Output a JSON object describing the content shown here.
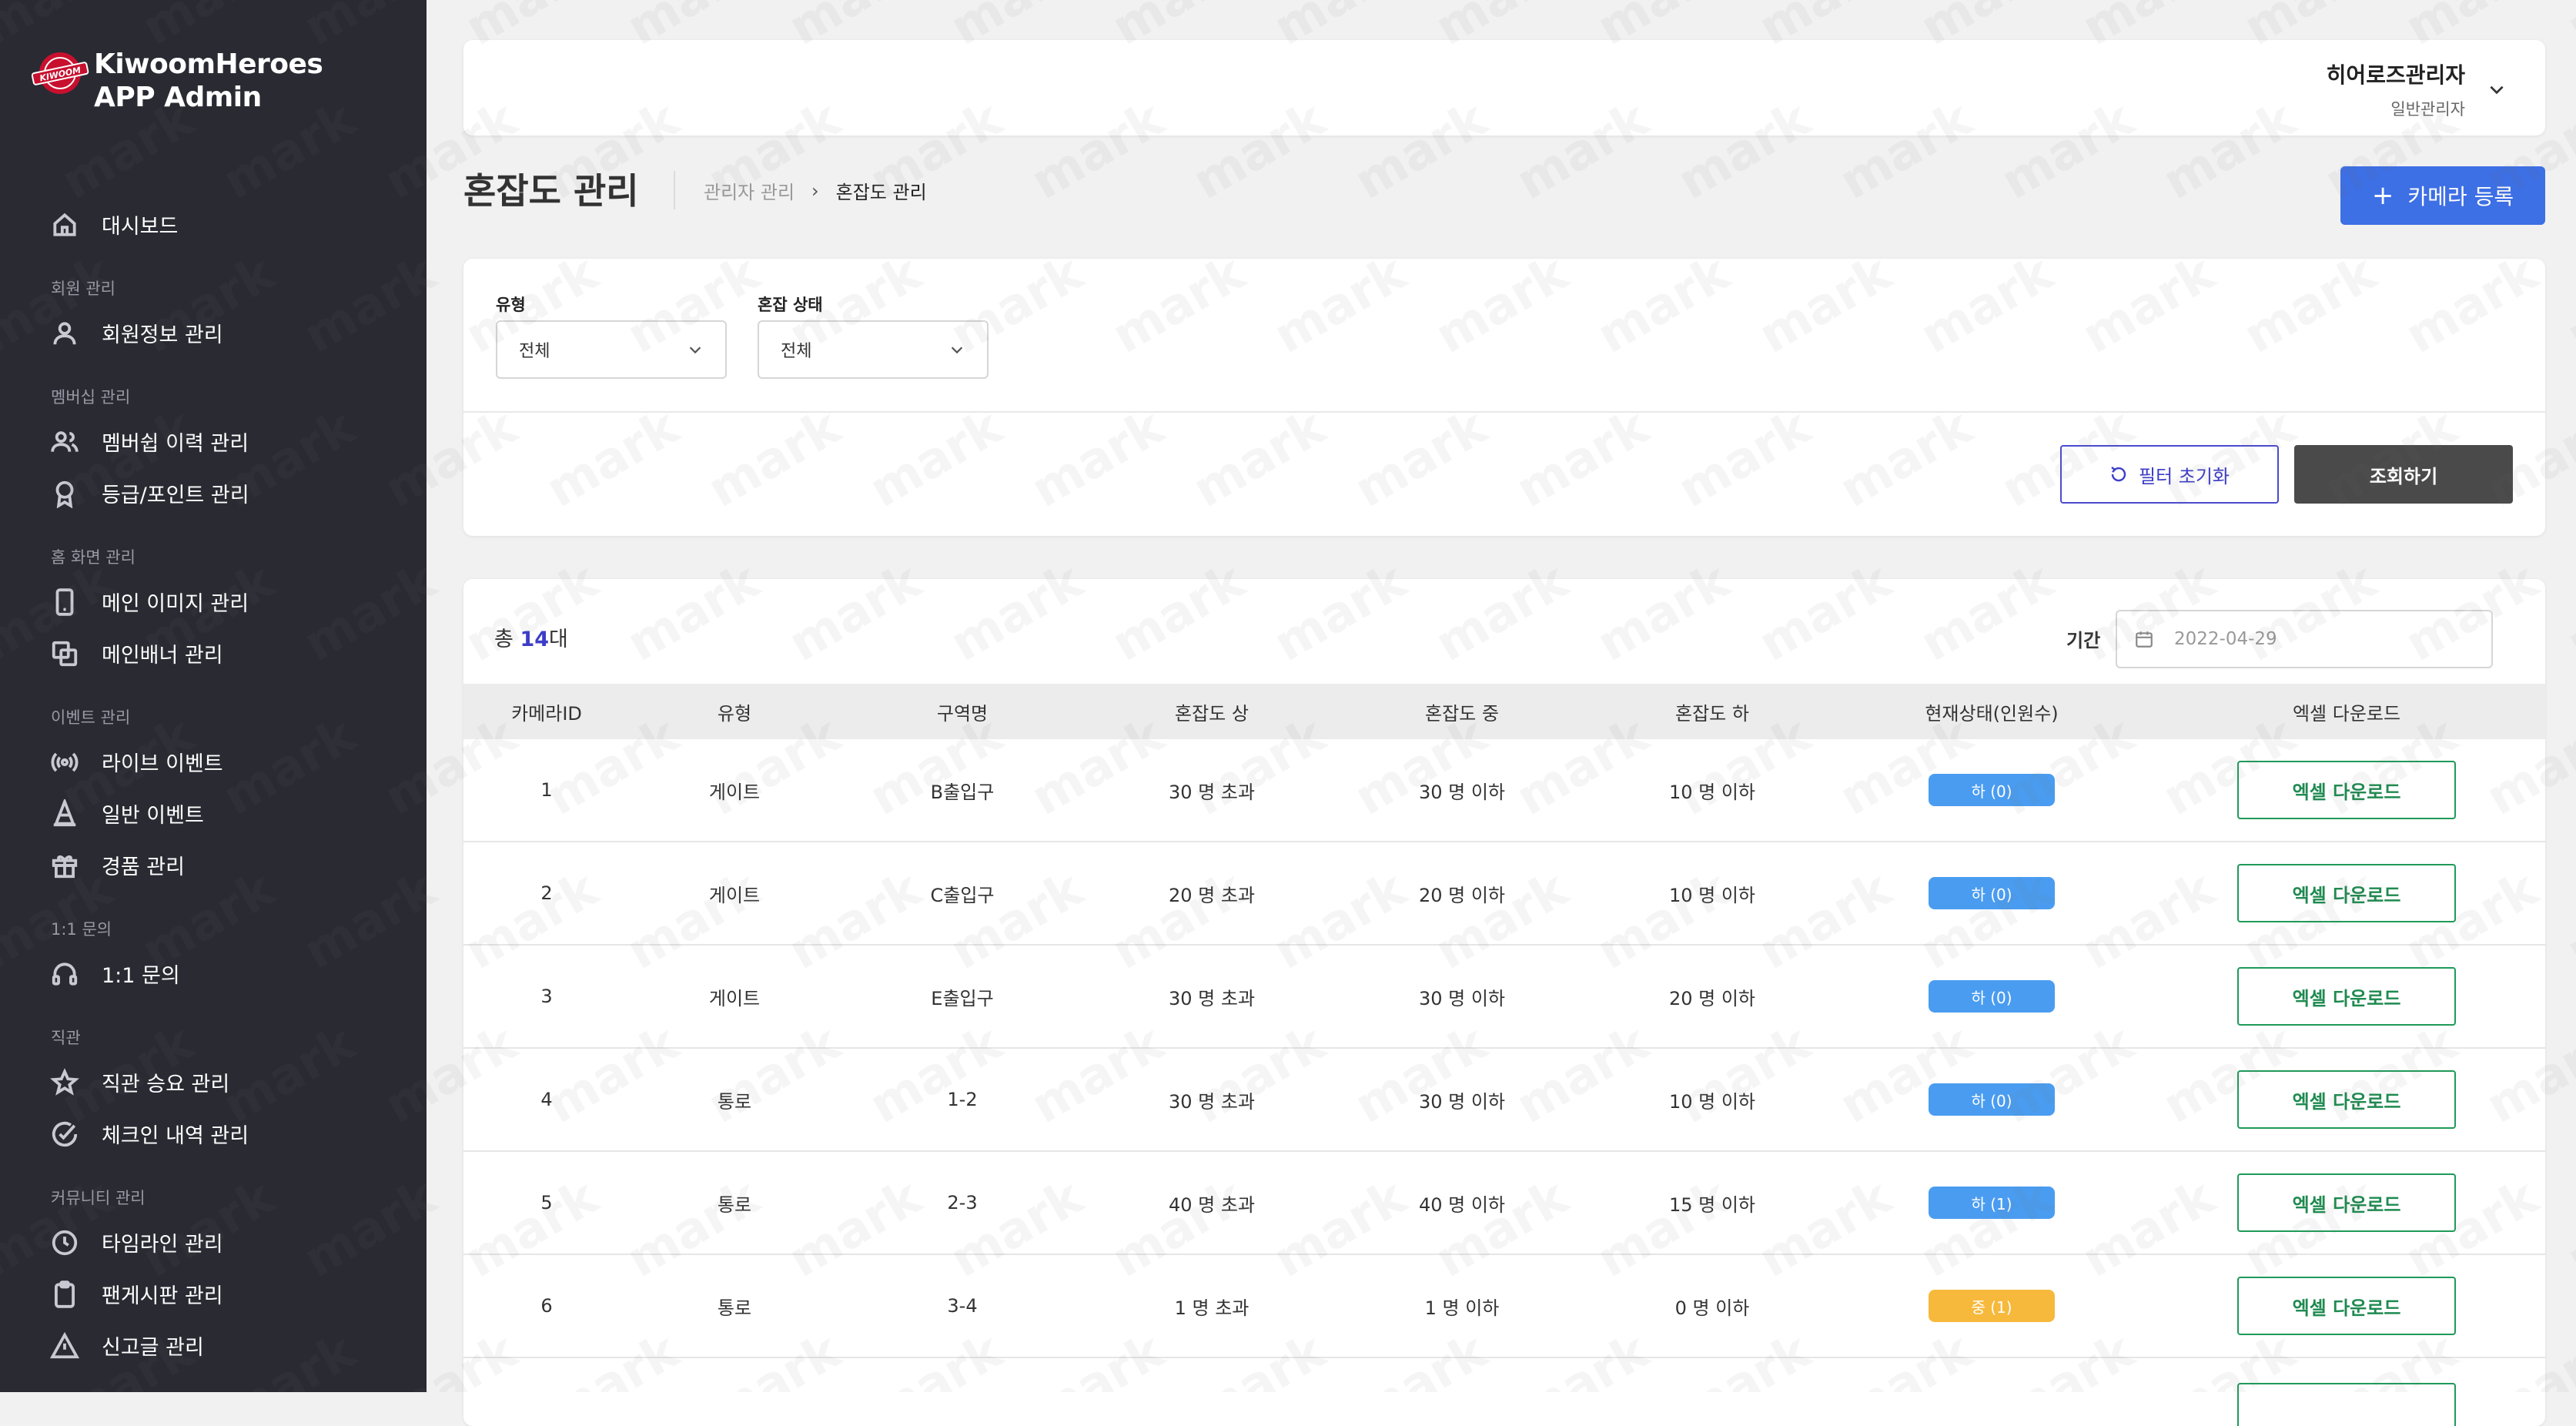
{
  "brand": {
    "line1": "KiwoomHeroes",
    "line2": "APP Admin",
    "logo_text": "KIWOOM"
  },
  "sidebar": {
    "sections": [
      {
        "title": "",
        "items": [
          {
            "label": "대시보드",
            "icon": "home-icon"
          }
        ]
      },
      {
        "title": "회원 관리",
        "items": [
          {
            "label": "회원정보 관리",
            "icon": "user-icon"
          }
        ]
      },
      {
        "title": "멤버십 관리",
        "items": [
          {
            "label": "멤버쉽 이력 관리",
            "icon": "users-icon"
          },
          {
            "label": "등급/포인트 관리",
            "icon": "award-icon"
          }
        ]
      },
      {
        "title": "홈 화면 관리",
        "items": [
          {
            "label": "메인 이미지 관리",
            "icon": "phone-icon"
          },
          {
            "label": "메인배너 관리",
            "icon": "copy-icon"
          }
        ]
      },
      {
        "title": "이벤트 관리",
        "items": [
          {
            "label": "라이브 이벤트",
            "icon": "broadcast-icon"
          },
          {
            "label": "일반 이벤트",
            "icon": "cone-icon"
          },
          {
            "label": "경품 관리",
            "icon": "gift-icon"
          }
        ]
      },
      {
        "title": "1:1 문의",
        "items": [
          {
            "label": "1:1 문의",
            "icon": "headset-icon"
          }
        ]
      },
      {
        "title": "직관",
        "items": [
          {
            "label": "직관 승요 관리",
            "icon": "star-icon"
          },
          {
            "label": "체크인 내역 관리",
            "icon": "check-circle-icon"
          }
        ]
      },
      {
        "title": "커뮤니티 관리",
        "items": [
          {
            "label": "타임라인 관리",
            "icon": "clock-icon"
          },
          {
            "label": "팬게시판 관리",
            "icon": "clipboard-icon"
          },
          {
            "label": "신고글 관리",
            "icon": "alert-icon"
          }
        ]
      }
    ]
  },
  "header": {
    "user_name": "히어로즈관리자",
    "user_role": "일반관리자"
  },
  "page": {
    "title": "혼잡도 관리",
    "breadcrumb": [
      "관리자 관리",
      "혼잡도 관리"
    ],
    "primary_button": "카메라 등록"
  },
  "filters": {
    "type_label": "유형",
    "type_value": "전체",
    "status_label": "혼잡 상태",
    "status_value": "전체",
    "reset_button": "필터 초기화",
    "search_button": "조회하기"
  },
  "table": {
    "total_prefix": "총 ",
    "total_count": "14",
    "total_suffix": "대",
    "period_label": "기간",
    "period_placeholder": "2022-04-29",
    "columns": [
      "카메라ID",
      "유형",
      "구역명",
      "혼잡도 상",
      "혼잡도 중",
      "혼잡도 하",
      "현재상태(인원수)",
      "엑셀 다운로드"
    ],
    "rows": [
      {
        "id": "1",
        "type": "게이트",
        "zone": "B출입구",
        "high": "30 명 초과",
        "mid": "30 명 이하",
        "low": "10 명 이하",
        "status": "하 (0)",
        "level": "low",
        "download": "엑셀 다운로드"
      },
      {
        "id": "2",
        "type": "게이트",
        "zone": "C출입구",
        "high": "20 명 초과",
        "mid": "20 명 이하",
        "low": "10 명 이하",
        "status": "하 (0)",
        "level": "low",
        "download": "엑셀 다운로드"
      },
      {
        "id": "3",
        "type": "게이트",
        "zone": "E출입구",
        "high": "30 명 초과",
        "mid": "30 명 이하",
        "low": "20 명 이하",
        "status": "하 (0)",
        "level": "low",
        "download": "엑셀 다운로드"
      },
      {
        "id": "4",
        "type": "통로",
        "zone": "1-2",
        "high": "30 명 초과",
        "mid": "30 명 이하",
        "low": "10 명 이하",
        "status": "하 (0)",
        "level": "low",
        "download": "엑셀 다운로드"
      },
      {
        "id": "5",
        "type": "통로",
        "zone": "2-3",
        "high": "40 명 초과",
        "mid": "40 명 이하",
        "low": "15 명 이하",
        "status": "하 (1)",
        "level": "low",
        "download": "엑셀 다운로드"
      },
      {
        "id": "6",
        "type": "통로",
        "zone": "3-4",
        "high": "1 명 초과",
        "mid": "1 명 이하",
        "low": "0 명 이하",
        "status": "중 (1)",
        "level": "mid",
        "download": "엑셀 다운로드"
      }
    ]
  },
  "watermark": "mark",
  "colors": {
    "sidebar_bg": "#2a2a33",
    "primary": "#3d6fe5",
    "accent": "#3d3dc8",
    "excel": "#1f8a50",
    "badge_low": "#4a9cf0",
    "badge_mid": "#f6b93b"
  }
}
